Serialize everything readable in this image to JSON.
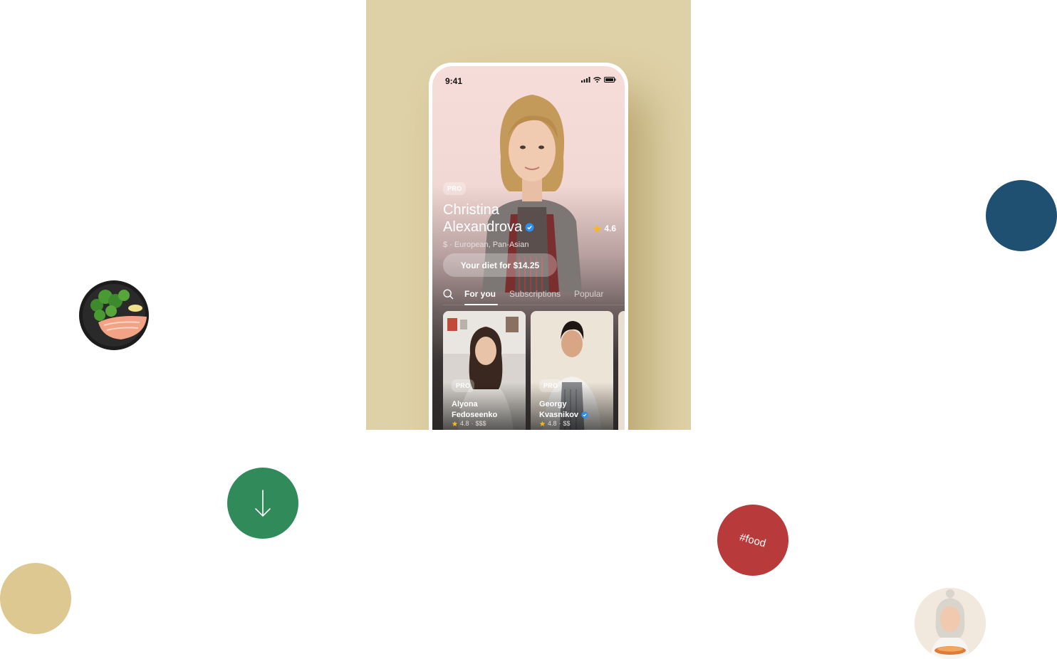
{
  "colors": {
    "stage_bg": "#dfd1a7",
    "blue_circle": "#1f5071",
    "green_circle": "#318a5a",
    "red_circle": "#b83a3a",
    "sand_circle": "#dcc890",
    "accent_verified": "#2d8ff0",
    "star": "#f5b820"
  },
  "status_bar": {
    "time": "9:41",
    "icons": [
      "signal-icon",
      "wifi-icon",
      "battery-icon"
    ]
  },
  "profile": {
    "badge": "PRO",
    "first_name": "Christina",
    "last_name": "Alexandrova",
    "rating": "4.6",
    "meta": "$ · European, Pan-Asian",
    "cta": "Your diet for $14.25"
  },
  "tabs": [
    {
      "label": "For you",
      "active": true
    },
    {
      "label": "Subscriptions",
      "active": false
    },
    {
      "label": "Popular",
      "active": false
    }
  ],
  "cards": [
    {
      "badge": "PRO",
      "first": "Alyona",
      "last": "Fedoseenko",
      "verified": false,
      "rating": "4.8",
      "price": "$$$"
    },
    {
      "badge": "PRO",
      "first": "Georgy",
      "last": "Kvasnikov",
      "verified": true,
      "rating": "4.8",
      "price": "$$"
    }
  ],
  "decor": {
    "food_tag": "#food"
  }
}
